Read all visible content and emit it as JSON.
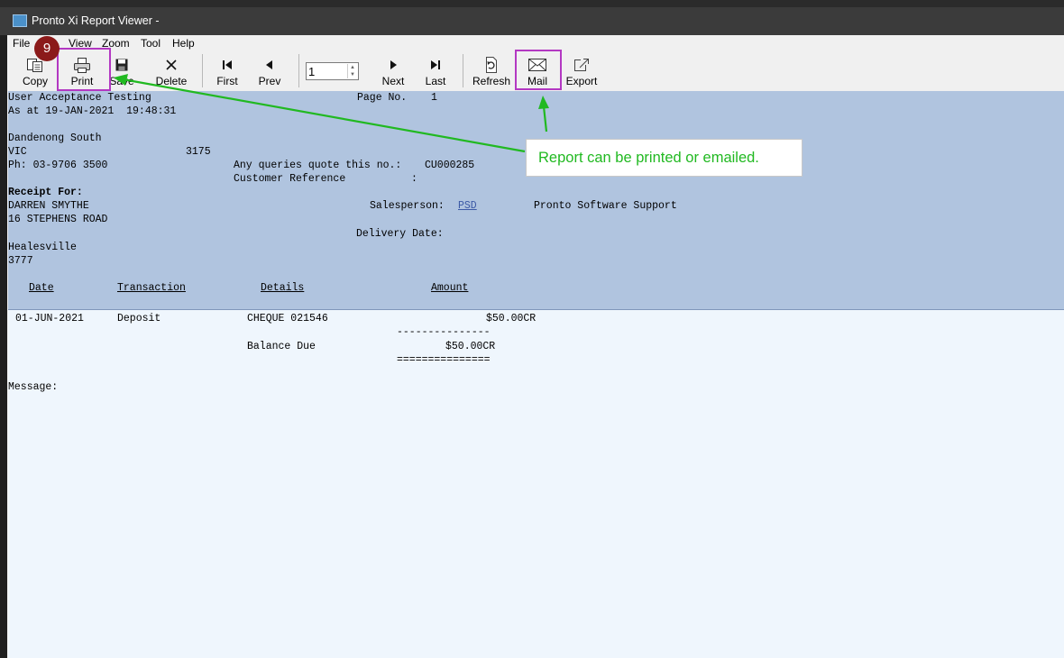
{
  "window": {
    "title": "Pronto Xi Report Viewer -"
  },
  "menu": [
    "File",
    "View",
    "Zoom",
    "Tool",
    "Help"
  ],
  "toolbar": {
    "copy": "Copy",
    "print": "Print",
    "save": "Save",
    "delete": "Delete",
    "first": "First",
    "prev": "Prev",
    "page_value": "1",
    "next": "Next",
    "last": "Last",
    "refresh": "Refresh",
    "mail": "Mail",
    "export": "Export"
  },
  "report": {
    "company": "User Acceptance Testing",
    "page_label": "Page No.",
    "page_no": "1",
    "as_at": "As at 19-JAN-2021  19:48:31",
    "address1": "Dandenong South",
    "state": "VIC",
    "postcode": "3175",
    "phone": "Ph: 03-9706 3500",
    "queries_label": "Any queries quote this no.:",
    "queries_value": "CU000285",
    "custref_label": "Customer Reference",
    "custref_colon": ":",
    "receipt_for": "Receipt For:",
    "customer_name": "DARREN SMYTHE",
    "customer_addr": "16 STEPHENS ROAD",
    "salesperson_label": "Salesperson:",
    "salesperson_code": "PSD",
    "salesperson_name": "Pronto Software Support",
    "delivery_label": "Delivery Date:",
    "customer_city": "Healesville",
    "customer_postcode": "3777",
    "columns": [
      "Date",
      "Transaction",
      "Details",
      "Amount"
    ],
    "rows": [
      {
        "date": "01-JUN-2021",
        "transaction": "Deposit",
        "details": "CHEQUE 021546",
        "amount": "$50.00CR"
      }
    ],
    "single_rule": "---------------",
    "balance_label": "Balance Due",
    "balance_amount": "$50.00CR",
    "double_rule": "===============",
    "message_label": "Message:"
  },
  "annotation": {
    "step_badge": "9",
    "callout": "Report can be printed or emailed.",
    "highlight_color": "#b338c2",
    "arrow_color": "#21b921"
  }
}
